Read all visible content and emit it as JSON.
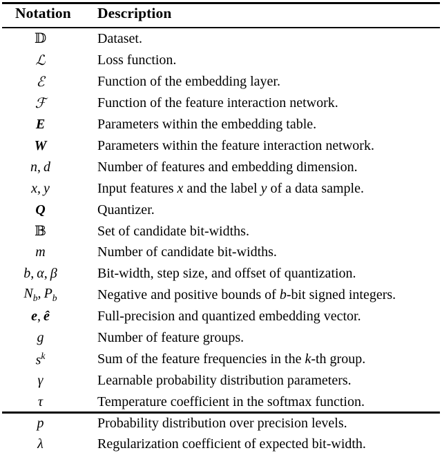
{
  "table": {
    "headers": {
      "notation": "Notation",
      "description": "Description"
    },
    "rows": [
      {
        "notation": "𝔻",
        "description": "Dataset."
      },
      {
        "notation": "ℒ",
        "description": "Loss function."
      },
      {
        "notation": "ℰ",
        "description": "Function of the embedding layer."
      },
      {
        "notation": "ℱ",
        "description": "Function of the feature interaction network."
      },
      {
        "notation": "E",
        "description": "Parameters within the embedding table."
      },
      {
        "notation": "W",
        "description": "Parameters within the feature interaction network."
      },
      {
        "notation": "n, d",
        "description": "Number of features and embedding dimension."
      },
      {
        "notation": "x, y",
        "description": "Input features x and the label y of a data sample."
      },
      {
        "notation": "Q",
        "description": "Quantizer."
      },
      {
        "notation": "𝔹",
        "description": "Set of candidate bit-widths."
      },
      {
        "notation": "m",
        "description": "Number of candidate bit-widths."
      },
      {
        "notation": "b, α, β",
        "description": "Bit-width, step size, and offset of quantization."
      },
      {
        "notation": "N_b, P_b",
        "description": "Negative and positive bounds of b-bit signed integers."
      },
      {
        "notation": "e, ê",
        "description": "Full-precision and quantized embedding vector."
      },
      {
        "notation": "g",
        "description": "Number of feature groups."
      },
      {
        "notation": "s^k",
        "description": "Sum of the feature frequencies in the k-th group."
      },
      {
        "notation": "γ",
        "description": "Learnable probability distribution parameters."
      },
      {
        "notation": "τ",
        "description": "Temperature coefficient in the softmax function."
      },
      {
        "notation": "p",
        "description": "Probability distribution over precision levels."
      },
      {
        "notation": "λ",
        "description": "Regularization coefficient of expected bit-width."
      }
    ]
  }
}
